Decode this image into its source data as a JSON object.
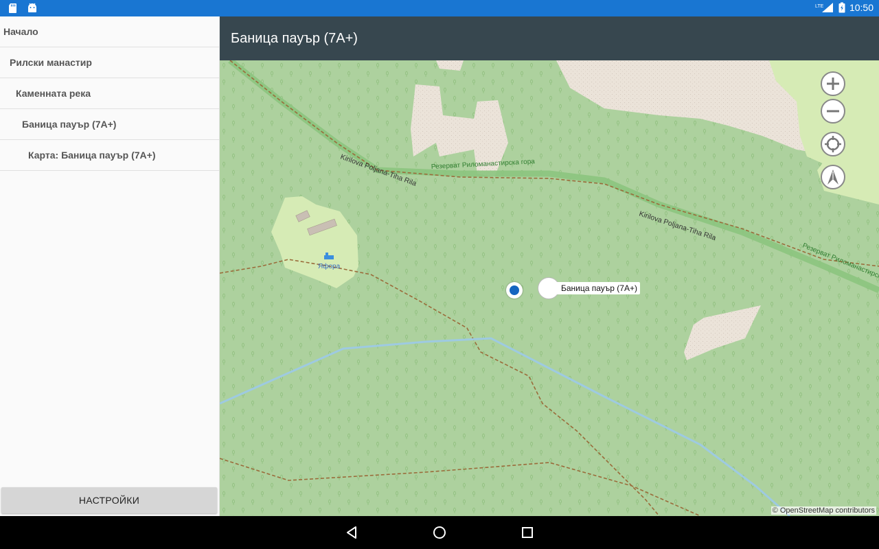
{
  "status_bar": {
    "time": "10:50",
    "network": "LTE",
    "icons": [
      "sd-card-icon",
      "android-debug-icon",
      "lte-signal-icon",
      "battery-charging-icon"
    ]
  },
  "drawer": {
    "items": [
      {
        "label": "Начало"
      },
      {
        "label": "Рилски манастир"
      },
      {
        "label": "Каменната река"
      },
      {
        "label": "Баница пауър (7A+)"
      },
      {
        "label": "Карта: Баница пауър (7A+)"
      }
    ],
    "settings_label": "НАСТРОЙКИ"
  },
  "appbar": {
    "title": "Баница пауър (7A+)"
  },
  "map": {
    "road_labels": [
      "Kirilova Poljana-Tiha Rila",
      "Kirilova Poljana-Tiha Rila"
    ],
    "reserve_labels": [
      "Резерват Риломанастирска гора",
      "Резерват Риломанастирска"
    ],
    "poi_label": "Яфора",
    "marker_label": "Баница пауър (7A+)",
    "attribution": "© OpenStreetMap contributors",
    "controls": [
      "zoom-in-icon",
      "zoom-out-icon",
      "my-location-icon",
      "compass-icon"
    ]
  },
  "colors": {
    "status_bar": "#1976d2",
    "app_bar": "#37474f",
    "forest": "#add19e",
    "meadow": "#d6ebb5",
    "rock": "#eee5dc",
    "marker_blue": "#1565c0"
  }
}
